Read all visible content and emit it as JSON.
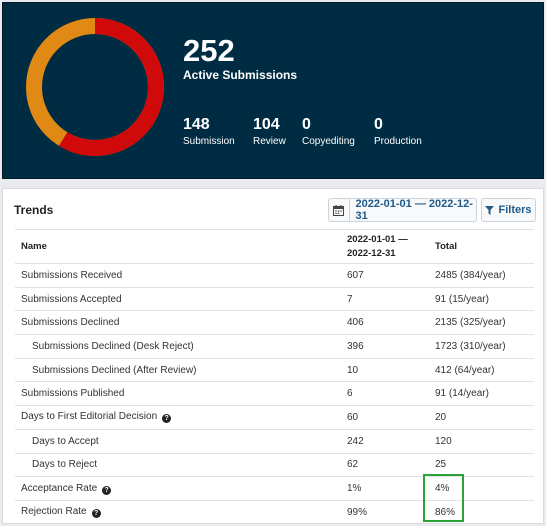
{
  "summary": {
    "active_count": "252",
    "active_label": "Active Submissions",
    "stages": [
      {
        "count": "148",
        "label": "Submission"
      },
      {
        "count": "104",
        "label": "Review"
      },
      {
        "count": "0",
        "label": "Copyediting"
      },
      {
        "count": "0",
        "label": "Production"
      }
    ],
    "donut_colors": {
      "submission": "#d00a0a",
      "review": "#e08914"
    }
  },
  "trends": {
    "title": "Trends",
    "date_range": "2022-01-01 — 2022-12-31",
    "filters_label": "Filters",
    "columns": {
      "name": "Name",
      "period_line1": "2022-01-01 —",
      "period_line2": "2022-12-31",
      "total": "Total"
    },
    "rows": [
      {
        "name": "Submissions Received",
        "period": "607",
        "total": "2485 (384/year)"
      },
      {
        "name": "Submissions Accepted",
        "period": "7",
        "total": "91 (15/year)"
      },
      {
        "name": "Submissions Declined",
        "period": "406",
        "total": "2135 (325/year)"
      },
      {
        "name": "Submissions Declined (Desk Reject)",
        "period": "396",
        "total": "1723 (310/year)"
      },
      {
        "name": "Submissions Declined (After Review)",
        "period": "10",
        "total": "412 (64/year)"
      },
      {
        "name": "Submissions Published",
        "period": "6",
        "total": "91 (14/year)"
      },
      {
        "name": "Days to First Editorial Decision",
        "period": "60",
        "total": "20"
      },
      {
        "name": "Days to Accept",
        "period": "242",
        "total": "120"
      },
      {
        "name": "Days to Reject",
        "period": "62",
        "total": "25"
      },
      {
        "name": "Acceptance Rate",
        "period": "1%",
        "total": "4%"
      },
      {
        "name": "Rejection Rate",
        "period": "99%",
        "total": "86%"
      }
    ]
  }
}
